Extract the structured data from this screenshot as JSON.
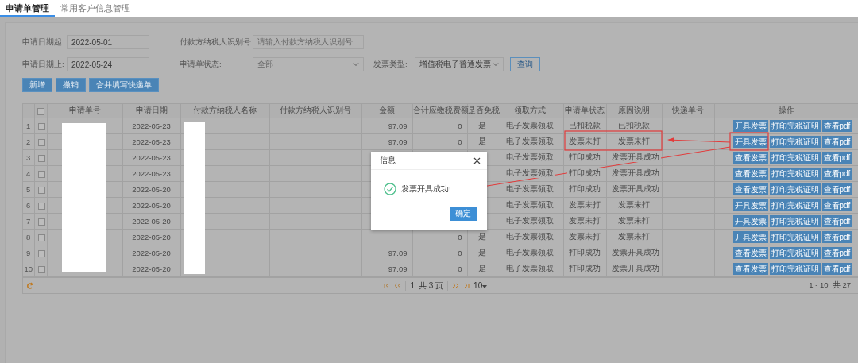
{
  "tabs": [
    {
      "label": "申请单管理",
      "selected": true
    },
    {
      "label": "常用客户信息管理",
      "selected": false
    }
  ],
  "filters": [
    {
      "kind": "text",
      "label": "申请日期起:",
      "value": "2022-05-01"
    },
    {
      "kind": "text",
      "label": "付款方纳税人识别号:",
      "placeholder": "请输入付款方纳税人识别号"
    },
    {
      "kind": "text",
      "label": "申请日期止:",
      "value": "2022-05-24"
    },
    {
      "kind": "select",
      "label": "申请单状态:",
      "placeholder": "全部"
    },
    {
      "kind": "select",
      "label": "发票类型:",
      "value": "增值税电子普通发票"
    }
  ],
  "search_button": "查询",
  "actions": [
    "新增",
    "撤销",
    "合并填写快递单"
  ],
  "table": {
    "header_checkbox": {
      "checked": false
    },
    "columns": [
      "申请单号",
      "申请日期",
      "付款方纳税人名称",
      "付款方纳税人识别号",
      "金额",
      "合计应缴税费额",
      "是否免税",
      "领取方式",
      "申请单状态",
      "原因说明",
      "快递单号",
      "操作"
    ],
    "rows": [
      {
        "no": "1",
        "checked": false,
        "date": "2022-05-23",
        "amount": "97.09",
        "tax": "0",
        "exempt": "是",
        "pickup": "电子发票领取",
        "status": "已扣税款",
        "reason": "已扣税款",
        "buttons": [
          "开具发票",
          "打印完税证明",
          "查看pdf"
        ]
      },
      {
        "no": "2",
        "checked": false,
        "date": "2022-05-23",
        "amount": "97.09",
        "tax": "0",
        "exempt": "是",
        "pickup": "电子发票领取",
        "status": "发票未打",
        "reason": "发票未打",
        "buttons": [
          "开具发票",
          "打印完税证明",
          "查看pdf"
        ]
      },
      {
        "no": "3",
        "checked": false,
        "date": "2022-05-23",
        "pickup": "电子发票领取",
        "status": "打印成功",
        "reason": "发票开具成功",
        "buttons": [
          "查看发票",
          "打印完税证明",
          "查看pdf"
        ]
      },
      {
        "no": "4",
        "checked": false,
        "date": "2022-05-23",
        "pickup": "电子发票领取",
        "status": "打印成功",
        "reason": "发票开具成功",
        "buttons": [
          "查看发票",
          "打印完税证明",
          "查看pdf"
        ]
      },
      {
        "no": "5",
        "checked": false,
        "date": "2022-05-20",
        "pickup": "电子发票领取",
        "status": "打印成功",
        "reason": "发票开具成功",
        "buttons": [
          "查看发票",
          "打印完税证明",
          "查看pdf"
        ]
      },
      {
        "no": "6",
        "checked": false,
        "date": "2022-05-20",
        "pickup": "电子发票领取",
        "status": "发票未打",
        "reason": "发票未打",
        "buttons": [
          "开具发票",
          "打印完税证明",
          "查看pdf"
        ]
      },
      {
        "no": "7",
        "checked": false,
        "date": "2022-05-20",
        "pickup": "电子发票领取",
        "status": "发票未打",
        "reason": "发票未打",
        "buttons": [
          "开具发票",
          "打印完税证明",
          "查看pdf"
        ]
      },
      {
        "no": "8",
        "checked": false,
        "date": "2022-05-20",
        "tax": "0",
        "exempt": "是",
        "pickup": "电子发票领取",
        "status": "发票未打",
        "reason": "发票未打",
        "buttons": [
          "开具发票",
          "打印完税证明",
          "查看pdf"
        ]
      },
      {
        "no": "9",
        "checked": false,
        "date": "2022-05-20",
        "amount": "97.09",
        "tax": "0",
        "exempt": "是",
        "pickup": "电子发票领取",
        "status": "打印成功",
        "reason": "发票开具成功",
        "buttons": [
          "查看发票",
          "打印完税证明",
          "查看pdf"
        ]
      },
      {
        "no": "10",
        "checked": false,
        "date": "2022-05-20",
        "amount": "97.09",
        "tax": "0",
        "exempt": "是",
        "pickup": "电子发票领取",
        "status": "打印成功",
        "reason": "发票开具成功",
        "buttons": [
          "查看发票",
          "打印完税证明",
          "查看pdf"
        ]
      }
    ]
  },
  "pagination": {
    "page": "1",
    "total_pages": "共 3 页",
    "page_size": "10",
    "summary": "1 - 10  共 27"
  },
  "dialog": {
    "title": "信息",
    "message": "发票开具成功!",
    "button": "确定"
  }
}
